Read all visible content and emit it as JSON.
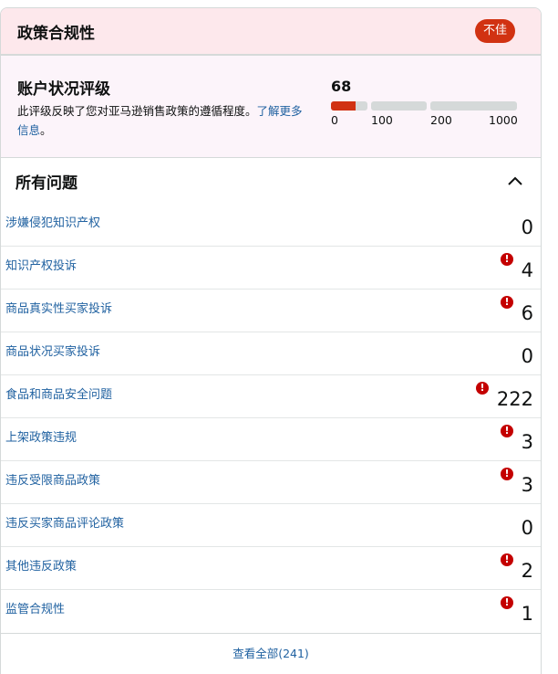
{
  "header": {
    "title": "政策合规性",
    "status_badge": "不佳"
  },
  "rating": {
    "title": "账户状况评级",
    "description": "此评级反映了您对亚马逊销售政策的遵循程度。",
    "link_text": "了解更多信息",
    "link_suffix": "。",
    "score": "68",
    "score_value": 68,
    "ticks": [
      "0",
      "100",
      "200",
      "1000"
    ]
  },
  "issues": {
    "title": "所有问题",
    "collapse_icon": "chevron-up-icon",
    "items": [
      {
        "label": "涉嫌侵犯知识产权",
        "count": "0",
        "alert": false
      },
      {
        "label": "知识产权投诉",
        "count": "4",
        "alert": true
      },
      {
        "label": "商品真实性买家投诉",
        "count": "6",
        "alert": true
      },
      {
        "label": "商品状况买家投诉",
        "count": "0",
        "alert": false
      },
      {
        "label": "食品和商品安全问题",
        "count": "222",
        "alert": true
      },
      {
        "label": "上架政策违规",
        "count": "3",
        "alert": true
      },
      {
        "label": "违反受限商品政策",
        "count": "3",
        "alert": true
      },
      {
        "label": "违反买家商品评论政策",
        "count": "0",
        "alert": false
      },
      {
        "label": "其他违反政策",
        "count": "2",
        "alert": true
      },
      {
        "label": "监管合规性",
        "count": "1",
        "alert": true
      }
    ],
    "alert_icon": "exclamation-icon"
  },
  "footer": {
    "view_all": "查看全部(241)"
  },
  "colors": {
    "accent_red": "#d13212",
    "alert_red": "#c40000",
    "link_blue": "#2162a1",
    "header_bg": "#fde8ec"
  }
}
